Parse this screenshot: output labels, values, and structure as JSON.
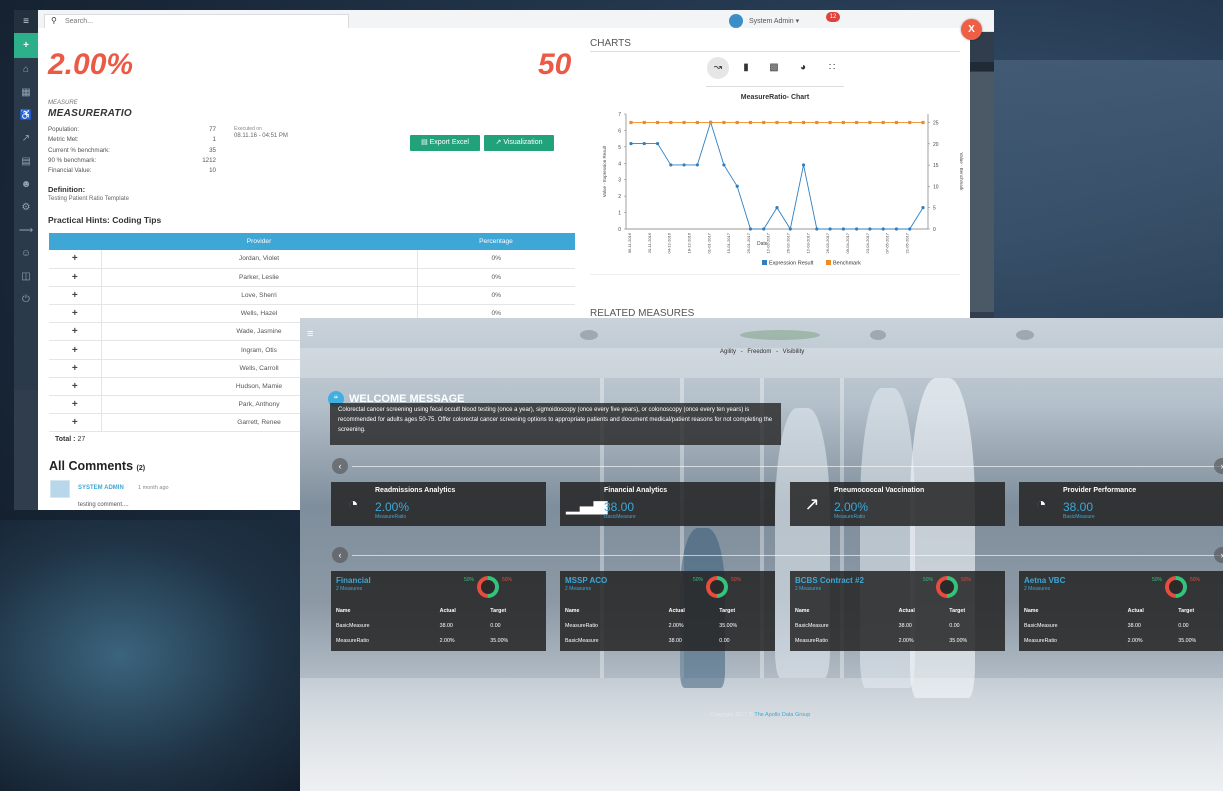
{
  "back_app": {
    "search_placeholder": "Search...",
    "user_name": "System Admin",
    "notification_count": "12"
  },
  "measure": {
    "value_left": "2.00%",
    "value_right": "50",
    "caption": "MEASURE",
    "name": "MEASURERATIO",
    "stats": [
      {
        "label": "Population:",
        "value": "77"
      },
      {
        "label": "Metric Met:",
        "value": "1"
      },
      {
        "label": "Current % benchmark:",
        "value": "35"
      },
      {
        "label": "90 % benchmark:",
        "value": "1212"
      },
      {
        "label": "Financial Value:",
        "value": "10"
      }
    ],
    "executed_label": "Executed on",
    "executed_value": "08.11.16 - 04:51 PM",
    "export_label": "Export Excel",
    "visualization_label": "Visualization",
    "definition_heading": "Definition:",
    "definition_text": "Testing Patient Ratio Template",
    "hints_heading": "Practical Hints: Coding Tips",
    "table": {
      "headers": [
        "",
        "Provider",
        "Percentage"
      ],
      "rows": [
        [
          "+",
          "Jordan, Violet",
          "0%"
        ],
        [
          "+",
          "Parker, Leslie",
          "0%"
        ],
        [
          "+",
          "Love, Sherri",
          "0%"
        ],
        [
          "+",
          "Wells, Hazel",
          "0%"
        ],
        [
          "+",
          "Wade, Jasmine",
          "0%"
        ],
        [
          "+",
          "Ingram, Otis",
          "0%"
        ],
        [
          "+",
          "Wells, Carroll",
          "0%"
        ],
        [
          "+",
          "Hudson, Mamie",
          "0%"
        ],
        [
          "+",
          "Park, Anthony",
          "0%"
        ],
        [
          "+",
          "Garrett, Renee",
          "0%"
        ]
      ]
    },
    "total_label": "Total :",
    "total_value": "27",
    "comments_heading": "All Comments",
    "comments_count": "(2)",
    "comment_user": "SYSTEM ADMIN",
    "comment_time": "1 month ago",
    "comment_text": "testing comment....",
    "close_label": "X",
    "charts_heading": "CHARTS",
    "related_heading": "RELATED MEASURES"
  },
  "chart_data": {
    "type": "line",
    "title": "MeasureRatio- Chart",
    "xlabel": "Date",
    "ylabel": "Value - Expression Result",
    "y2label": "Value - Benchmark",
    "x": [
      "2016-11-01",
      "2016-11-08",
      "2016-11-15",
      "2016-11-22",
      "2016-11-29",
      "2016-12-06",
      "2016-12-13",
      "2016-12-20",
      "2016-12-27",
      "2017-01-03",
      "2017-01-10",
      "2017-01-17",
      "2017-01-24",
      "2017-01-31",
      "2017-02-07",
      "2017-02-14",
      "2017-02-21",
      "2017-02-28",
      "2017-03-07",
      "2017-03-14",
      "2017-03-21",
      "2017-03-28",
      "2017-04-04",
      "2017-04-11",
      "2017-04-18",
      "2017-04-25",
      "2017-05-02",
      "2017-05-09",
      "2017-05-16",
      "2017-05-23",
      "2017-05-30"
    ],
    "x_tick_labels": [
      "06-11-2016",
      "20-11-2016",
      "04-12-2016",
      "18-12-2016",
      "01-01-2017",
      "15-01-2017",
      "29-01-2017",
      "12-02-2017",
      "26-02-2017",
      "12-03-2017",
      "26-03-2017",
      "09-04-2017",
      "23-04-2017",
      "07-05-2017",
      "21-05-2017"
    ],
    "series": [
      {
        "name": "Expression Result",
        "color": "#2f7fc1",
        "values": [
          5.2,
          5.2,
          5.2,
          3.9,
          3.9,
          3.9,
          6.5,
          3.9,
          2.6,
          0,
          0,
          1.3,
          0,
          3.9,
          0,
          0,
          0,
          0,
          0,
          0,
          0,
          0,
          1.3
        ]
      },
      {
        "name": "Benchmark",
        "color": "#f08a24",
        "values": [
          25,
          25,
          25,
          25,
          25,
          25,
          25,
          25,
          25,
          25,
          25,
          25,
          25,
          25,
          25,
          25,
          25,
          25,
          25,
          25,
          25,
          25,
          25
        ]
      }
    ],
    "ylim": [
      0,
      7
    ],
    "y2lim": [
      0,
      27
    ],
    "y_ticks": [
      0,
      1,
      2,
      3,
      4,
      5,
      6,
      7
    ],
    "y2_ticks": [
      0,
      5,
      10,
      15,
      20,
      25
    ],
    "legend_position": "bottom"
  },
  "dashboard": {
    "tagline": "Agility  -  Freedom  -  Visibility",
    "welcome_title": "WELCOME MESSAGE",
    "welcome_text": "Colorectal cancer screening using fecal occult blood testing (once a year), sigmoidoscopy (once every five years), or colonoscopy (once every ten years) is recommended for adults ages 50-75. Offer colorectal cancer screening options to appropriate patients and document medical/patient reasons for not completing the screening.",
    "cards": [
      {
        "title": "Readmissions Analytics",
        "value": "2.00%",
        "sub": "MeasureRatio",
        "icon": "gauge-icon"
      },
      {
        "title": "Financial Analytics",
        "value": "38.00",
        "sub": "BasicMeasure",
        "icon": "bar-chart-icon"
      },
      {
        "title": "Pneumococcal Vaccination",
        "value": "2.00%",
        "sub": "MeasureRatio",
        "icon": "line-chart-icon"
      },
      {
        "title": "Provider Performance",
        "value": "38.00",
        "sub": "BasicMeasure",
        "icon": "gauge-icon"
      }
    ],
    "contracts": [
      {
        "title": "Financial",
        "sub": "2 Measures",
        "pct_green": "50%",
        "pct_red": "50%",
        "headers": [
          "Name",
          "Actual",
          "Target"
        ],
        "rows": [
          [
            "BasicMeasure",
            "38.00",
            "0.00"
          ],
          [
            "MeasureRatio",
            "2.00%",
            "35.00%"
          ]
        ]
      },
      {
        "title": "MSSP ACO",
        "sub": "2 Measures",
        "pct_green": "50%",
        "pct_red": "50%",
        "headers": [
          "Name",
          "Actual",
          "Target"
        ],
        "rows": [
          [
            "MeasureRatio",
            "2.00%",
            "35.00%"
          ],
          [
            "BasicMeasure",
            "38.00",
            "0.00"
          ]
        ]
      },
      {
        "title": "BCBS Contract #2",
        "sub": "2 Measures",
        "pct_green": "50%",
        "pct_red": "50%",
        "headers": [
          "Name",
          "Actual",
          "Target"
        ],
        "rows": [
          [
            "BasicMeasure",
            "38.00",
            "0.00"
          ],
          [
            "MeasureRatio",
            "2.00%",
            "35.00%"
          ]
        ]
      },
      {
        "title": "Aetna VBC",
        "sub": "2 Measures",
        "pct_green": "50%",
        "pct_red": "50%",
        "headers": [
          "Name",
          "Actual",
          "Target"
        ],
        "rows": [
          [
            "BasicMeasure",
            "38.00",
            "0.00"
          ],
          [
            "MeasureRatio",
            "2.00%",
            "35.00%"
          ]
        ]
      }
    ],
    "copyright_prefix": "Copyright 2017 ©",
    "copyright_company": "The Apollo Data Group"
  }
}
